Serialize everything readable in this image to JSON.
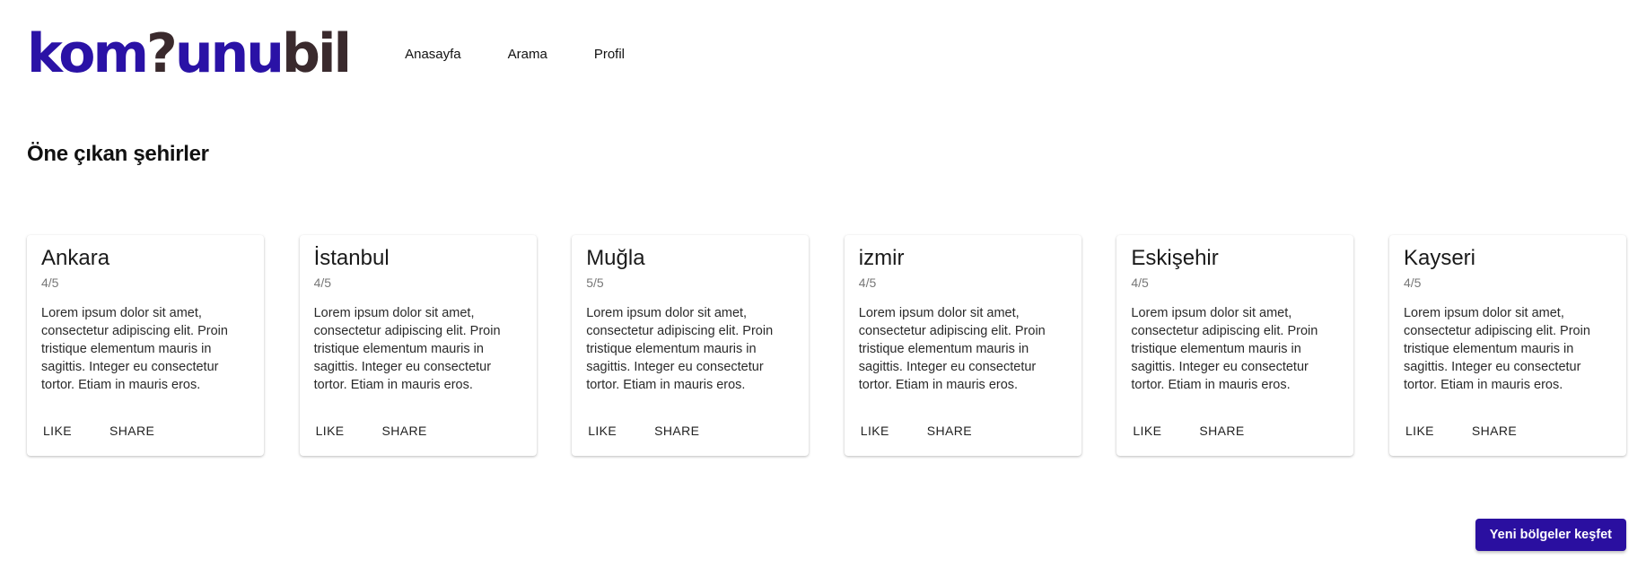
{
  "logo": {
    "part1": "kom",
    "part2": "?",
    "part3": "unu",
    "part4": "bil"
  },
  "nav": {
    "items": [
      {
        "label": "Anasayfa"
      },
      {
        "label": "Arama"
      },
      {
        "label": "Profil"
      }
    ]
  },
  "section": {
    "title": "Öne çıkan şehirler"
  },
  "cards": [
    {
      "title": "Ankara",
      "rating": "4/5",
      "text": "Lorem ipsum dolor sit amet, consectetur adipiscing elit. Proin tristique elementum mauris in sagittis. Integer eu consectetur tortor. Etiam in mauris eros.",
      "like": "LIKE",
      "share": "SHARE"
    },
    {
      "title": "İstanbul",
      "rating": "4/5",
      "text": "Lorem ipsum dolor sit amet, consectetur adipiscing elit. Proin tristique elementum mauris in sagittis. Integer eu consectetur tortor. Etiam in mauris eros.",
      "like": "LIKE",
      "share": "SHARE"
    },
    {
      "title": "Muğla",
      "rating": "5/5",
      "text": "Lorem ipsum dolor sit amet, consectetur adipiscing elit. Proin tristique elementum mauris in sagittis. Integer eu consectetur tortor. Etiam in mauris eros.",
      "like": "LIKE",
      "share": "SHARE"
    },
    {
      "title": "izmir",
      "rating": "4/5",
      "text": "Lorem ipsum dolor sit amet, consectetur adipiscing elit. Proin tristique elementum mauris in sagittis. Integer eu consectetur tortor. Etiam in mauris eros.",
      "like": "LIKE",
      "share": "SHARE"
    },
    {
      "title": "Eskişehir",
      "rating": "4/5",
      "text": "Lorem ipsum dolor sit amet, consectetur adipiscing elit. Proin tristique elementum mauris in sagittis. Integer eu consectetur tortor. Etiam in mauris eros.",
      "like": "LIKE",
      "share": "SHARE"
    },
    {
      "title": "Kayseri",
      "rating": "4/5",
      "text": "Lorem ipsum dolor sit amet, consectetur adipiscing elit. Proin tristique elementum mauris in sagittis. Integer eu consectetur tortor. Etiam in mauris eros.",
      "like": "LIKE",
      "share": "SHARE"
    }
  ],
  "cta": {
    "label": "Yeni bölgeler keşfet"
  },
  "colors": {
    "brand": "#2a12a6",
    "brand_dark": "#3a2a2d",
    "cta_bg": "#2a0fa0"
  }
}
